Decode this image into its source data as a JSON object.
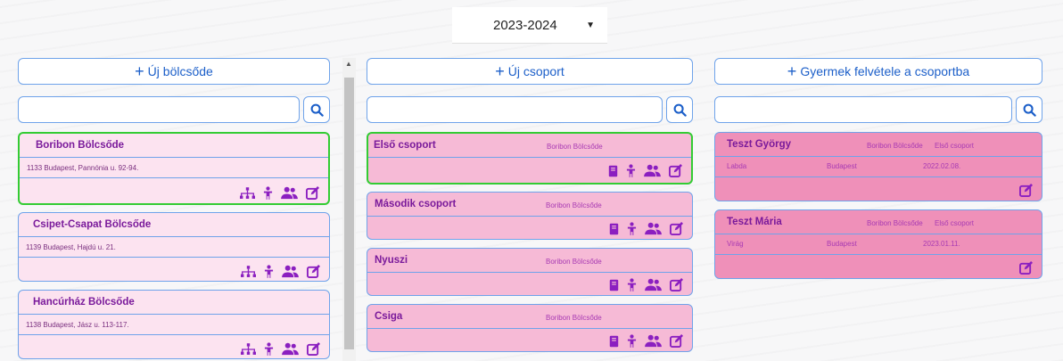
{
  "year_select": {
    "value": "2023-2024",
    "icon": "caret-down-icon"
  },
  "colors": {
    "nursery_card": "#fce3f0",
    "group_card": "#f6bad6",
    "child_card": "#ef90b9",
    "accent": "#1c5fc9",
    "icon_purple": "#8b1fc0",
    "selected_border": "#33cc33"
  },
  "nurseries": {
    "add_label": "Új bölcsőde",
    "items": [
      {
        "name": "Boribon Bölcsőde",
        "address": "1133 Budapest, Pannónia u. 92-94."
      },
      {
        "name": "Csipet-Csapat Bölcsőde",
        "address": "1139 Budapest, Hajdú u. 21."
      },
      {
        "name": "Hancúrház Bölcsőde",
        "address": "1138 Budapest, Jász u. 113-117."
      }
    ]
  },
  "groups": {
    "add_label": "Új csoport",
    "items": [
      {
        "name": "Első csoport",
        "nursery": "Boribon Bölcsőde"
      },
      {
        "name": "Második csoport",
        "nursery": "Boribon Bölcsőde"
      },
      {
        "name": "Nyuszi",
        "nursery": "Boribon Bölcsőde"
      },
      {
        "name": "Csiga",
        "nursery": "Boribon Bölcsőde"
      }
    ]
  },
  "children": {
    "add_label": "Gyermek felvétele a csoportba",
    "items": [
      {
        "name": "Teszt György",
        "nursery": "Boribon Bölcsőde",
        "group": "Első csoport",
        "sign": "Labda",
        "city": "Budapest",
        "date": "2022.02.08."
      },
      {
        "name": "Teszt Mária",
        "nursery": "Boribon Bölcsőde",
        "group": "Első csoport",
        "sign": "Virág",
        "city": "Budapest",
        "date": "2023.01.11."
      }
    ]
  }
}
